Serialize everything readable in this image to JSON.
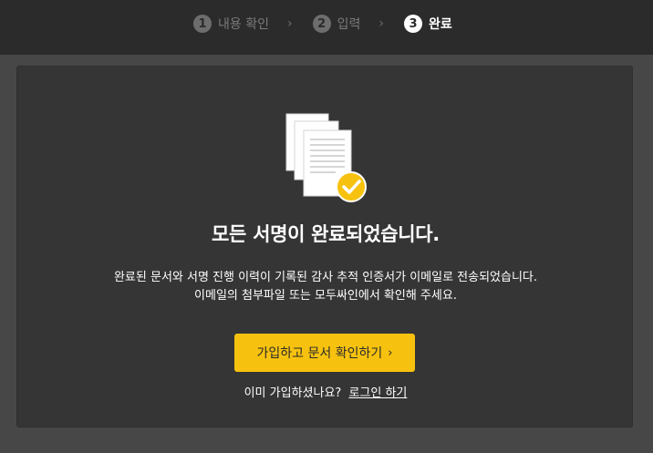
{
  "steps": [
    {
      "number": "1",
      "label": "내용 확인",
      "state": "done"
    },
    {
      "number": "2",
      "label": "입력",
      "state": "done"
    },
    {
      "number": "3",
      "label": "완료",
      "state": "active"
    }
  ],
  "main": {
    "title": "모든 서명이 완료되었습니다.",
    "description_line1": "완료된 문서와 서명 진행 이력이 기록된 감사 추적 인증서가 이메일로 전송되었습니다.",
    "description_line2": "이메일의 첨부파일 또는 모두싸인에서 확인해 주세요.",
    "cta_label": "가입하고 문서 확인하기",
    "already_member_text": "이미 가입하셨나요?",
    "login_link_label": "로그인 하기"
  },
  "colors": {
    "accent": "#f7c20f",
    "background": "#474747",
    "card": "#353535",
    "topbar": "#2b2b2b"
  }
}
